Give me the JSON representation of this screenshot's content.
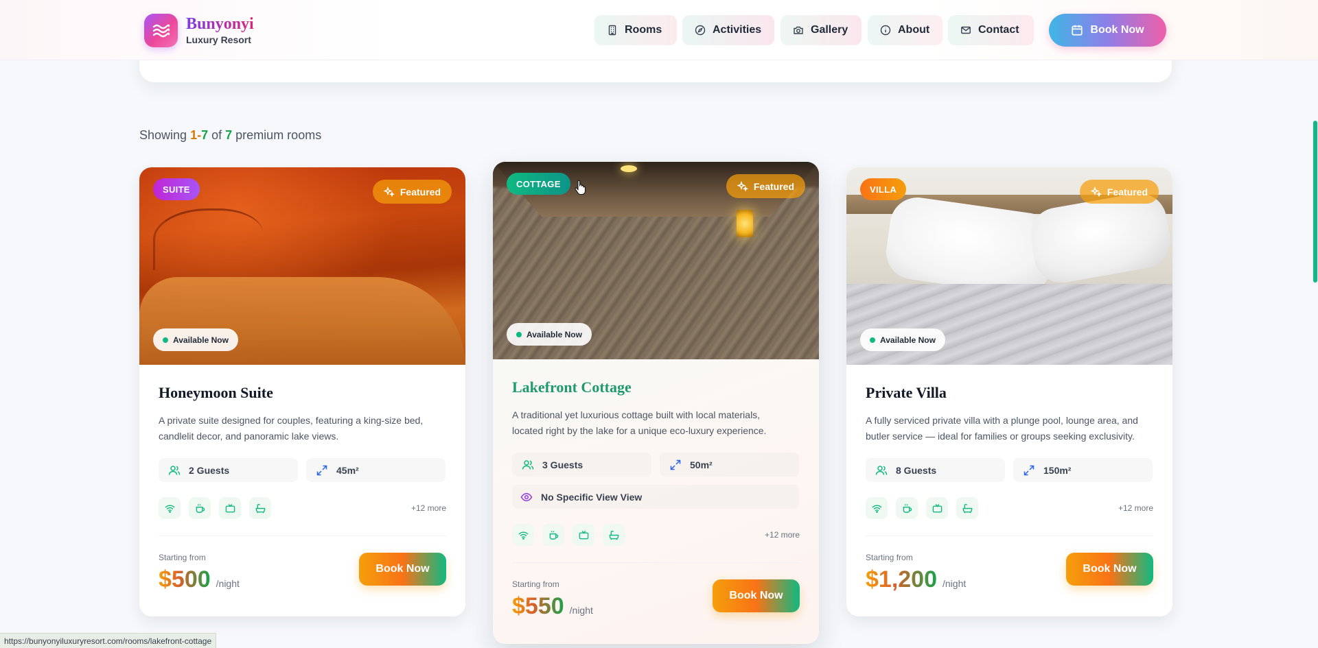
{
  "header": {
    "brand_name": "Bunyonyi",
    "brand_sub": "Luxury Resort",
    "nav": [
      {
        "label": "Rooms",
        "icon": "building-icon"
      },
      {
        "label": "Activities",
        "icon": "compass-icon"
      },
      {
        "label": "Gallery",
        "icon": "camera-icon"
      },
      {
        "label": "About",
        "icon": "info-icon"
      },
      {
        "label": "Contact",
        "icon": "mail-icon"
      }
    ],
    "book_now": "Book Now"
  },
  "results": {
    "prefix": "Showing",
    "range_start": "1",
    "dash": "-",
    "range_end": "7",
    "of": "of",
    "total": "7",
    "suffix": "premium rooms"
  },
  "rooms": [
    {
      "type": "SUITE",
      "featured": "Featured",
      "availability": "Available Now",
      "title": "Honeymoon Suite",
      "description": "A private suite designed for couples, featuring a king-size bed, candlelit decor, and panoramic lake views.",
      "guests": "2 Guests",
      "size": "45m²",
      "more_amenities": "+12 more",
      "starting_from": "Starting from",
      "price": "$500",
      "per_night": "/night",
      "book_label": "Book Now"
    },
    {
      "type": "COTTAGE",
      "featured": "Featured",
      "availability": "Available Now",
      "title": "Lakefront Cottage",
      "description": "A traditional yet luxurious cottage built with local materials, located right by the lake for a unique eco-luxury experience.",
      "guests": "3 Guests",
      "size": "50m²",
      "view": "No Specific View View",
      "more_amenities": "+12 more",
      "starting_from": "Starting from",
      "price": "$550",
      "per_night": "/night",
      "book_label": "Book Now"
    },
    {
      "type": "VILLA",
      "featured": "Featured",
      "availability": "Available Now",
      "title": "Private Villa",
      "description": "A fully serviced private villa with a plunge pool, lounge area, and butler service — ideal for families or groups seeking exclusivity.",
      "guests": "8 Guests",
      "size": "150m²",
      "more_amenities": "+12 more",
      "starting_from": "Starting from",
      "price": "$1,200",
      "per_night": "/night",
      "book_label": "Book Now"
    }
  ],
  "amenity_icons": [
    "wifi-icon",
    "coffee-icon",
    "tv-icon",
    "bath-icon"
  ],
  "status_bar": {
    "url": "https://bunyonyiluxuryresort.com/rooms/lakefront-cottage"
  },
  "colors": {
    "accent_green": "#10b981",
    "accent_orange": "#f59e0b",
    "accent_pink": "#ec4899",
    "accent_purple": "#a855f7"
  }
}
